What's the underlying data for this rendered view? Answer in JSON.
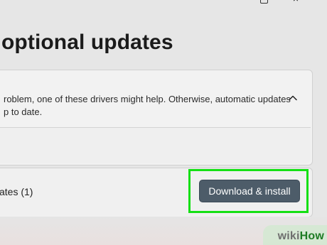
{
  "window": {
    "controls": [
      {
        "name": "minimize-icon"
      },
      {
        "name": "maximize-icon"
      },
      {
        "name": "close-icon"
      }
    ]
  },
  "page": {
    "title": "optional updates"
  },
  "driver_card": {
    "description_lines": [
      "roblem, one of these drivers might help. Otherwise, automatic updates",
      "p to date."
    ],
    "collapse_icon": "chevron-up-icon"
  },
  "updates": {
    "count_label": "ates (1)",
    "download_button_label": "Download & install"
  },
  "highlight_color": "#14e014",
  "button_color": "#4d5c69",
  "watermark": {
    "part1": "wiki",
    "part2": "How"
  }
}
